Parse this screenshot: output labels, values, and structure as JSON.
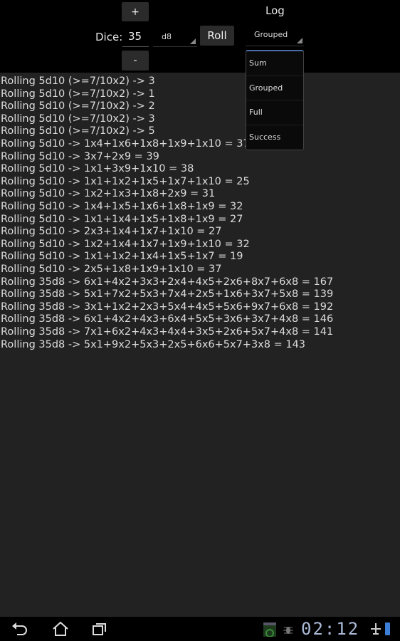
{
  "controls": {
    "plus_label": "+",
    "minus_label": "-",
    "dice_label": "Dice:",
    "dice_count": "35",
    "die_type": "d8",
    "roll_label": "Roll",
    "log_label": "Log",
    "log_mode": "Grouped"
  },
  "dropdown": {
    "options": [
      "Sum",
      "Grouped",
      "Full",
      "Success"
    ]
  },
  "log": [
    "Rolling 5d10 (>=7/10x2) -> 3",
    "Rolling 5d10 (>=7/10x2) -> 1",
    "Rolling 5d10 (>=7/10x2) -> 2",
    "Rolling 5d10 (>=7/10x2) -> 3",
    "Rolling 5d10 (>=7/10x2) -> 5",
    "Rolling 5d10 -> 1x4+1x6+1x8+1x9+1x10 = 37",
    "Rolling 5d10 -> 3x7+2x9 = 39",
    "Rolling 5d10 -> 1x1+3x9+1x10 = 38",
    "Rolling 5d10 -> 1x1+1x2+1x5+1x7+1x10 = 25",
    "Rolling 5d10 -> 1x2+1x3+1x8+2x9 = 31",
    "Rolling 5d10 -> 1x4+1x5+1x6+1x8+1x9 = 32",
    "Rolling 5d10 -> 1x1+1x4+1x5+1x8+1x9 = 27",
    "Rolling 5d10 -> 2x3+1x4+1x7+1x10 = 27",
    "Rolling 5d10 -> 1x2+1x4+1x7+1x9+1x10 = 32",
    "Rolling 5d10 -> 1x1+1x2+1x4+1x5+1x7 = 19",
    "Rolling 5d10 -> 2x5+1x8+1x9+1x10 = 37",
    "Rolling 35d8 -> 6x1+4x2+3x3+2x4+4x5+2x6+8x7+6x8 = 167",
    "Rolling 35d8 -> 5x1+7x2+5x3+7x4+2x5+1x6+3x7+5x8 = 139",
    "Rolling 35d8 -> 3x1+1x2+2x3+5x4+4x5+5x6+9x7+6x8 = 192",
    "Rolling 35d8 -> 6x1+4x2+4x3+6x4+5x5+3x6+3x7+4x8 = 146",
    "Rolling 35d8 -> 7x1+6x2+4x3+4x4+3x5+2x6+5x7+4x8 = 141",
    "Rolling 35d8 -> 5x1+9x2+5x3+2x5+6x6+5x7+3x8 = 143"
  ],
  "statusbar": {
    "time": "02:12",
    "icons": [
      "back-icon",
      "home-icon",
      "recent-apps-icon",
      "gallery-notification-icon",
      "debug-icon",
      "airplane-mode-icon",
      "battery-icon"
    ]
  },
  "colors": {
    "accent": "#4a6ea8",
    "battery": "#3b7fd8",
    "clock": "#a9b9d6"
  }
}
